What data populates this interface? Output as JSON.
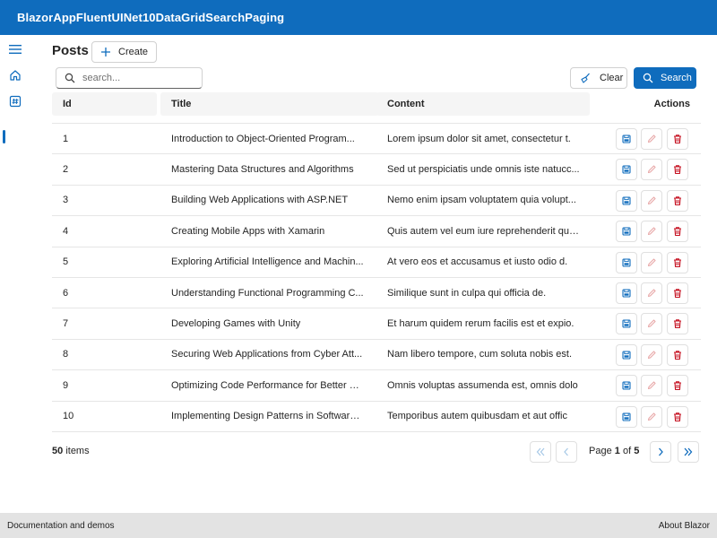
{
  "app": {
    "title": "BlazorAppFluentUINet10DataGridSearchPaging"
  },
  "nav": {
    "menu_icon": "hamburger-icon",
    "items": [
      {
        "icon": "home-icon"
      },
      {
        "icon": "grid-icon",
        "active": true
      }
    ]
  },
  "page": {
    "title": "Posts",
    "create_label": "Create"
  },
  "search": {
    "placeholder": "search...",
    "value": "",
    "clear_label": "Clear",
    "search_label": "Search"
  },
  "grid": {
    "columns": [
      "Id",
      "Title",
      "Content",
      "Actions"
    ],
    "rows": [
      {
        "id": "1",
        "title": "Introduction to Object-Oriented Program...",
        "content": "Lorem ipsum dolor sit amet, consectetur t."
      },
      {
        "id": "2",
        "title": "Mastering Data Structures and Algorithms",
        "content": "Sed ut perspiciatis unde omnis iste natucc..."
      },
      {
        "id": "3",
        "title": "Building Web Applications with ASP.NET",
        "content": "Nemo enim ipsam voluptatem quia volupt..."
      },
      {
        "id": "4",
        "title": "Creating Mobile Apps with Xamarin",
        "content": "Quis autem vel eum iure reprehenderit que..."
      },
      {
        "id": "5",
        "title": "Exploring Artificial Intelligence and Machin...",
        "content": "At vero eos et accusamus et iusto odio d."
      },
      {
        "id": "6",
        "title": "Understanding Functional Programming C...",
        "content": "Similique sunt in culpa qui officia de."
      },
      {
        "id": "7",
        "title": "Developing Games with Unity",
        "content": "Et harum quidem rerum facilis est et expio."
      },
      {
        "id": "8",
        "title": "Securing Web Applications from Cyber Att...",
        "content": "Nam libero tempore, cum soluta nobis est."
      },
      {
        "id": "9",
        "title": "Optimizing Code Performance for Better Ef...",
        "content": "Omnis voluptas assumenda est, omnis dolo"
      },
      {
        "id": "10",
        "title": "Implementing Design Patterns in Software ...",
        "content": "Temporibus autem quibusdam et aut offic"
      }
    ],
    "action_icons": [
      "save-icon",
      "edit-icon",
      "delete-icon"
    ]
  },
  "pager": {
    "total": "50",
    "items_label": "items",
    "page_label": "Page",
    "current": "1",
    "of_label": "of",
    "total_pages": "5"
  },
  "footer": {
    "left_link": "Documentation and demos",
    "right_link": "About Blazor"
  },
  "colors": {
    "brand": "#0f6cbd",
    "delete": "#c50f1f",
    "edit": "#e8a8a8",
    "save": "#0f6cbd"
  }
}
